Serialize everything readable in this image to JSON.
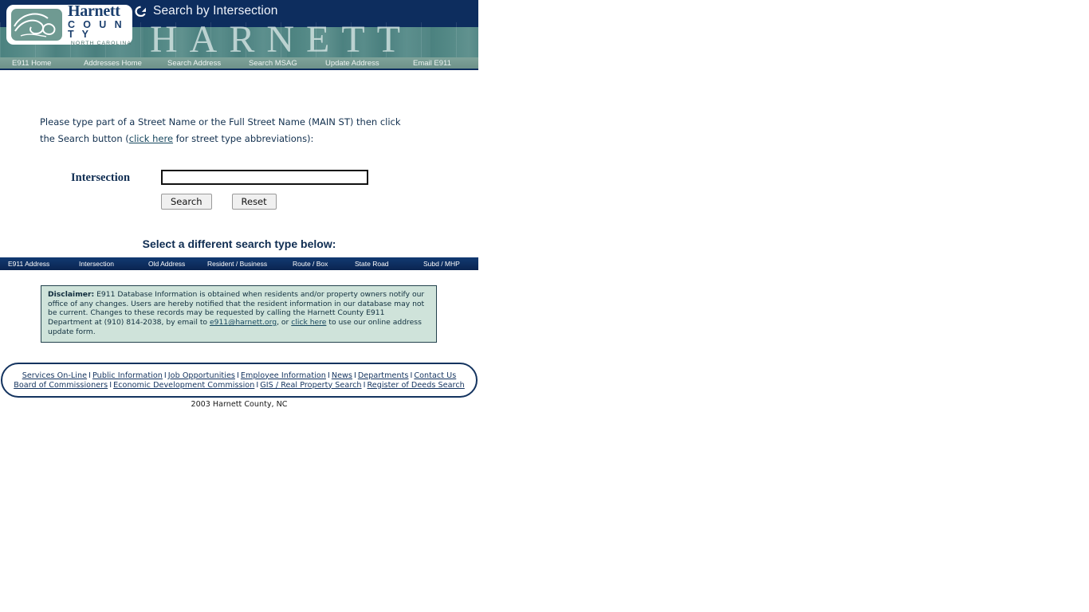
{
  "titlebar": {
    "icon": "redo-circular-arrow-icon",
    "title": "Search by Intersection",
    "bg_color": "#0d2d5e"
  },
  "logo": {
    "name": "Harnett",
    "county": "C O U N T Y",
    "state": "NORTH CAROLINA",
    "mark_color": "#6f9a92"
  },
  "banner": {
    "wordmark": "HARNETT",
    "tint_color": "#3a7676"
  },
  "top_nav": {
    "items": [
      {
        "label": "E911 Home"
      },
      {
        "label": "Addresses Home"
      },
      {
        "label": "Search Address"
      },
      {
        "label": "Search MSAG"
      },
      {
        "label": "Update Address"
      },
      {
        "label": "Email E911"
      }
    ]
  },
  "intro": {
    "line1_before": "Please type part of a Street Name or the Full Street Name (MAIN ST) then click",
    "line2_before": "the Search button (",
    "link": "click here",
    "line2_after": " for street type abbreviations):"
  },
  "form": {
    "label": "Intersection",
    "value": "",
    "placeholder": "",
    "search_label": "Search",
    "reset_label": "Reset"
  },
  "section": {
    "title": "Select a different search type below:"
  },
  "search_types": {
    "items": [
      {
        "label": "E911 Address"
      },
      {
        "label": "Intersection"
      },
      {
        "label": "Old Address"
      },
      {
        "label": "Resident / Business"
      },
      {
        "label": "Route / Box"
      },
      {
        "label": "State Road"
      },
      {
        "label": "Subd / MHP"
      }
    ]
  },
  "disclaimer": {
    "heading": "Disclaimer:",
    "text_1": " E911 Database Information is obtained when residents and/or property owners notify our office of any changes. Users are hereby notified that the resident information in our database may not be current. Changes to these records may be requested by calling the Harnett County E911 Department at (910) 814-2038, by email to ",
    "email": "e911@harnett.org",
    "text_2": ", or ",
    "link": "click here",
    "text_3": " to use our online address update form.",
    "bg_color": "#cfe3da"
  },
  "footer": {
    "row1": [
      {
        "label": "Services On-Line"
      },
      {
        "label": "Public Information"
      },
      {
        "label": "Job Opportunities"
      },
      {
        "label": "Employee Information"
      },
      {
        "label": "News"
      },
      {
        "label": "Departments"
      },
      {
        "label": "Contact Us"
      }
    ],
    "row2": [
      {
        "label": "Board of Commissioners"
      },
      {
        "label": "Economic Development Commission"
      },
      {
        "label": "GIS / Real Property Search"
      },
      {
        "label": "Register of Deeds Search"
      }
    ],
    "separator": "I",
    "copyright": "2003 Harnett County, NC"
  }
}
